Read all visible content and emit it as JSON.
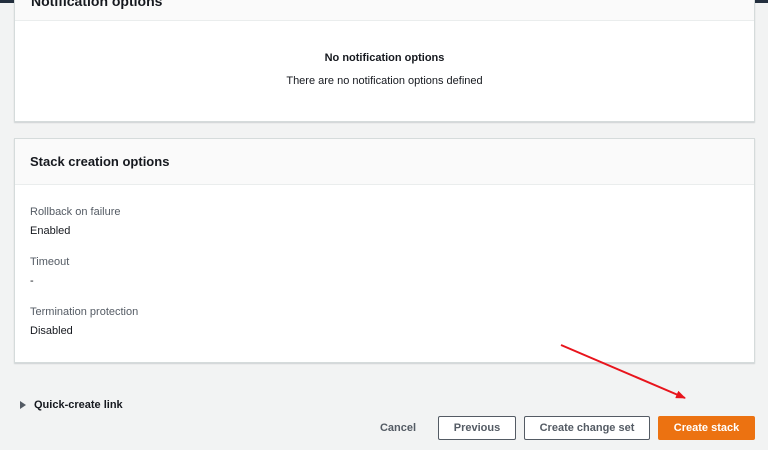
{
  "notification_panel": {
    "title": "Notification options",
    "empty_title": "No notification options",
    "empty_description": "There are no notification options defined"
  },
  "stack_creation_panel": {
    "title": "Stack creation options",
    "fields": [
      {
        "label": "Rollback on failure",
        "value": "Enabled"
      },
      {
        "label": "Timeout",
        "value": "-"
      },
      {
        "label": "Termination protection",
        "value": "Disabled"
      }
    ]
  },
  "quick_create_link": {
    "label": "Quick-create link"
  },
  "footer": {
    "cancel_label": "Cancel",
    "previous_label": "Previous",
    "create_change_set_label": "Create change set",
    "create_stack_label": "Create stack"
  },
  "colors": {
    "primary_button": "#ec7211",
    "annotation_arrow": "#e8141c",
    "page_background": "#f2f3f3"
  },
  "icons": {
    "quick_create_toggle": "caret-right-icon"
  }
}
